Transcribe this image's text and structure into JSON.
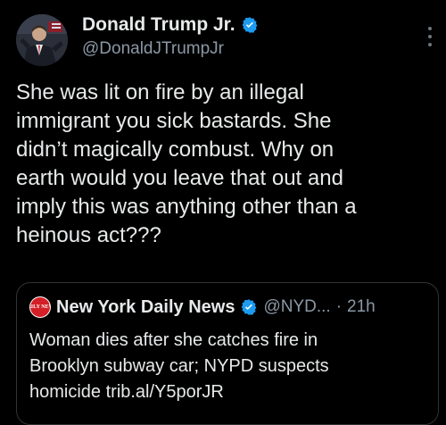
{
  "tweet": {
    "author_name": "Donald Trump Jr.",
    "author_handle": "@DonaldJTrumpJr",
    "text": "She was lit on fire by an illegal\nimmigrant you sick bastards. She\ndidn’t magically combust. Why on\nearth would you leave that out and\nimply this was anything other than a\nheinous act???",
    "verified_icon": "verified-badge-icon",
    "more_icon": "more-vertical-icon"
  },
  "quote": {
    "logo_text": "DAILY NEWS",
    "author_name": "New York Daily News",
    "author_handle": "@NYD...",
    "separator": "·",
    "time": "21h",
    "text": "Woman dies after she catches fire in\nBrooklyn subway car; NYPD suspects\nhomicide trib.al/Y5porJR"
  },
  "colors": {
    "background": "#000000",
    "text_primary": "#e7e9ea",
    "text_secondary": "#8b98a5",
    "verified_blue": "#1d9bf0",
    "card_border": "#2f3336",
    "logo_red": "#d41f26"
  }
}
